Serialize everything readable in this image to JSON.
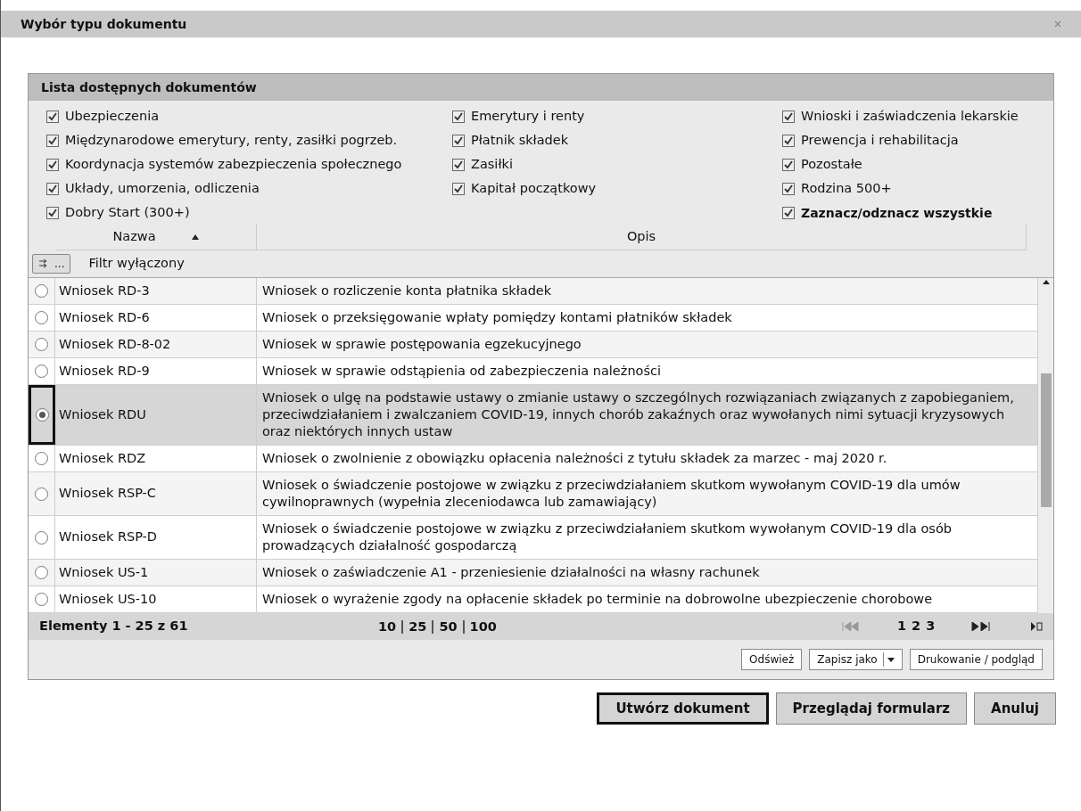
{
  "window": {
    "title": "Wybór typu dokumentu"
  },
  "panel": {
    "title": "Lista dostępnych dokumentów",
    "filters": [
      [
        {
          "label": "Ubezpieczenia",
          "checked": true,
          "kind": "category"
        },
        {
          "label": "Międzynarodowe emerytury, renty, zasiłki pogrzeb.",
          "checked": true,
          "kind": "category"
        },
        {
          "label": "Koordynacja systemów zabezpieczenia społecznego",
          "checked": true,
          "kind": "category"
        },
        {
          "label": "Układy, umorzenia, odliczenia",
          "checked": true,
          "kind": "category"
        },
        {
          "label": "Dobry Start (300+)",
          "checked": true,
          "kind": "category"
        }
      ],
      [
        {
          "label": "Emerytury i renty",
          "checked": true,
          "kind": "category"
        },
        {
          "label": "Płatnik składek",
          "checked": true,
          "kind": "category"
        },
        {
          "label": "Zasiłki",
          "checked": true,
          "kind": "category"
        },
        {
          "label": "Kapitał początkowy",
          "checked": true,
          "kind": "category"
        }
      ],
      [
        {
          "label": "Wnioski i zaświadczenia lekarskie",
          "checked": true,
          "kind": "category"
        },
        {
          "label": "Prewencja i rehabilitacja",
          "checked": true,
          "kind": "category"
        },
        {
          "label": "Pozostałe",
          "checked": true,
          "kind": "category"
        },
        {
          "label": "Rodzina 500+",
          "checked": true,
          "kind": "category"
        },
        {
          "label": "Zaznacz/odznacz wszystkie",
          "checked": true,
          "kind": "toggle_all"
        }
      ]
    ],
    "table": {
      "columns": [
        {
          "label": "Nazwa",
          "sorted": true
        },
        {
          "label": "Opis",
          "sorted": false
        }
      ],
      "filter_status": "Filtr wyłączony",
      "filter_button": "...",
      "rows": [
        {
          "name": "Wniosek RD-3",
          "description": "Wniosek o rozliczenie konta płatnika składek",
          "selected": false
        },
        {
          "name": "Wniosek RD-6",
          "description": "Wniosek o przeksięgowanie wpłaty pomiędzy kontami płatników składek",
          "selected": false
        },
        {
          "name": "Wniosek RD-8-02",
          "description": "Wniosek w sprawie postępowania egzekucyjnego",
          "selected": false
        },
        {
          "name": "Wniosek RD-9",
          "description": "Wniosek w sprawie odstąpienia od zabezpieczenia należności",
          "selected": false
        },
        {
          "name": "Wniosek RDU",
          "description": "Wniosek o ulgę na podstawie ustawy o zmianie ustawy o szczególnych rozwiązaniach związanych z zapobieganiem, przeciwdziałaniem i zwalczaniem COVID-19, innych chorób zakaźnych oraz wywołanych nimi sytuacji kryzysowych oraz niektórych innych ustaw",
          "selected": true
        },
        {
          "name": "Wniosek RDZ",
          "description": "Wniosek o zwolnienie z obowiązku opłacenia należności z tytułu składek za marzec - maj 2020 r.",
          "selected": false
        },
        {
          "name": "Wniosek RSP-C",
          "description": "Wniosek o świadczenie postojowe w związku z przeciwdziałaniem skutkom wywołanym COVID-19 dla umów cywilnoprawnych (wypełnia zleceniodawca lub zamawiający)",
          "selected": false
        },
        {
          "name": "Wniosek RSP-D",
          "description": "Wniosek o świadczenie postojowe w związku z przeciwdziałaniem skutkom wywołanym COVID-19 dla osób prowadzących działalność gospodarczą",
          "selected": false
        },
        {
          "name": "Wniosek US-1",
          "description": "Wniosek o zaświadczenie A1 - przeniesienie działalności na własny rachunek",
          "selected": false
        },
        {
          "name": "Wniosek US-10",
          "description": "Wniosek o wyrażenie zgody na opłacenie składek po terminie na dobrowolne ubezpieczenie chorobowe",
          "selected": false
        }
      ],
      "pager": {
        "summary": "Elementy 1 - 25 z 61",
        "page_sizes": [
          "10",
          "25",
          "50",
          "100"
        ],
        "pages": [
          "1",
          "2",
          "3"
        ]
      },
      "toolbar": [
        {
          "label": "Odśwież",
          "kind": "plain"
        },
        {
          "label": "Zapisz jako",
          "kind": "dropdown"
        },
        {
          "label": "Drukowanie / podgląd",
          "kind": "plain"
        }
      ]
    }
  },
  "buttons": [
    {
      "label": "Utwórz dokument",
      "focused": true
    },
    {
      "label": "Przeglądaj formularz",
      "focused": false
    },
    {
      "label": "Anuluj",
      "focused": false
    }
  ]
}
